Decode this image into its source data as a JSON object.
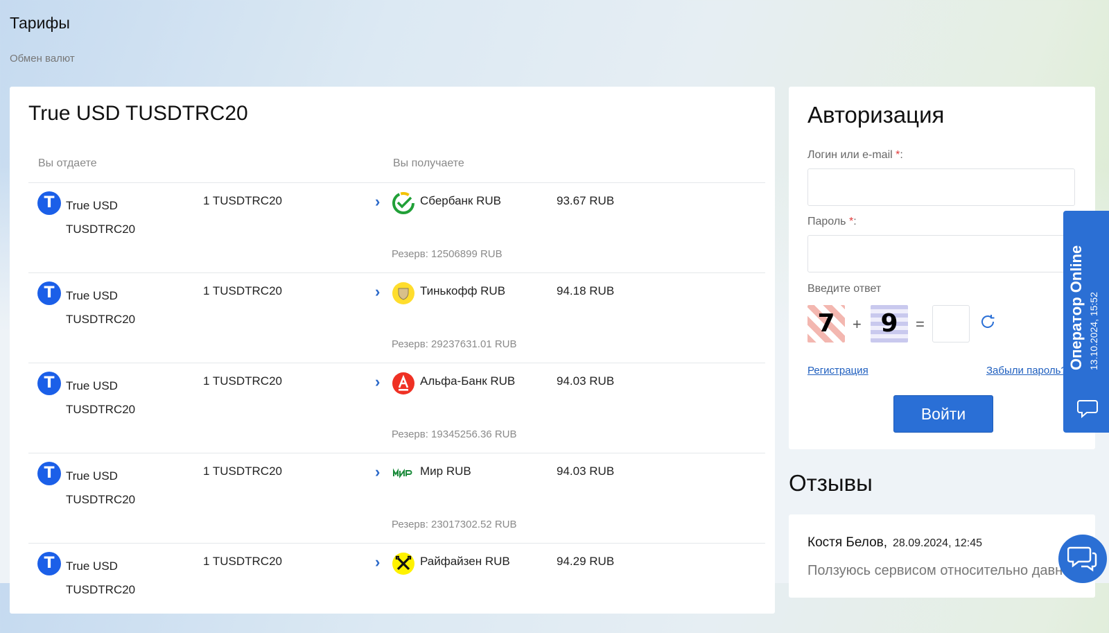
{
  "page": {
    "title": "Тарифы",
    "breadcrumb": "Обмен валют"
  },
  "main": {
    "title": "True USD TUSDTRC20",
    "col_give": "Вы отдаете",
    "col_get": "Вы получаете",
    "rows": [
      {
        "coin": "True USD TUSDTRC20",
        "give": "1 TUSDTRC20",
        "bank": "Сбербанк RUB",
        "get": "93.67 RUB",
        "reserve": "Резерв: 12506899 RUB",
        "bank_icon": "sberbank-icon"
      },
      {
        "coin": "True USD TUSDTRC20",
        "give": "1 TUSDTRC20",
        "bank": "Тинькофф RUB",
        "get": "94.18 RUB",
        "reserve": "Резерв: 29237631.01 RUB",
        "bank_icon": "tinkoff-icon"
      },
      {
        "coin": "True USD TUSDTRC20",
        "give": "1 TUSDTRC20",
        "bank": "Альфа-Банк RUB",
        "get": "94.03 RUB",
        "reserve": "Резерв: 19345256.36 RUB",
        "bank_icon": "alfabank-icon"
      },
      {
        "coin": "True USD TUSDTRC20",
        "give": "1 TUSDTRC20",
        "bank": "Мир RUB",
        "get": "94.03 RUB",
        "reserve": "Резерв: 23017302.52 RUB",
        "bank_icon": "mir-icon"
      },
      {
        "coin": "True USD TUSDTRC20",
        "give": "1 TUSDTRC20",
        "bank": "Райфайзен RUB",
        "get": "94.29 RUB",
        "reserve": "",
        "bank_icon": "raiffeisen-icon"
      }
    ]
  },
  "auth": {
    "title": "Авторизация",
    "login_label": "Логин или e-mail",
    "password_label": "Пароль",
    "required_mark": "*",
    "label_colon": ":",
    "login_value": "",
    "password_value": "",
    "captcha_label": "Введите ответ",
    "captcha_a": "7",
    "captcha_op": "+",
    "captcha_b": "9",
    "captcha_eq": "=",
    "captcha_answer": "",
    "register_link": "Регистрация",
    "forgot_link": "Забыли пароль?",
    "submit": "Войти"
  },
  "reviews": {
    "title": "Отзывы",
    "author": "Костя Белов,",
    "date": "28.09.2024, 12:45",
    "text": "Ползуюсь сервисом относительно давно"
  },
  "operator": {
    "title": "Оператор Online",
    "date": "13.10.2024, 15:52"
  },
  "colors": {
    "accent": "#2a6fd6",
    "coin": "#1b5fe8",
    "required": "#e23b3b"
  }
}
